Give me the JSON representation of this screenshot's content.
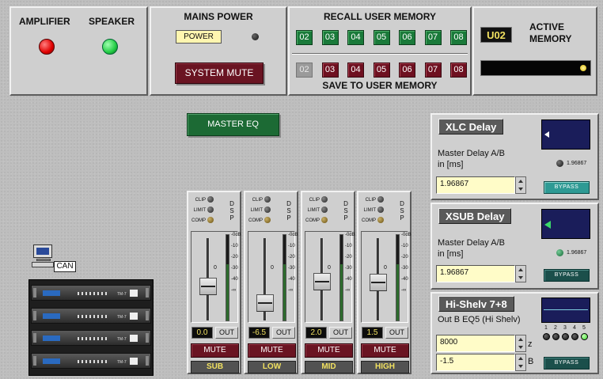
{
  "status": {
    "amplifier_label": "AMPLIFIER",
    "speaker_label": "SPEAKER",
    "amplifier_led_color": "#e00000",
    "speaker_led_color": "#22cc44"
  },
  "mains": {
    "title": "MAINS POWER",
    "power_label": "POWER",
    "system_mute_label": "SYSTEM MUTE"
  },
  "memory": {
    "recall_title": "RECALL USER MEMORY",
    "save_title": "SAVE TO USER MEMORY",
    "recall_slots": [
      "02",
      "03",
      "04",
      "05",
      "06",
      "07",
      "08"
    ],
    "save_slots": [
      "02",
      "03",
      "04",
      "05",
      "06",
      "07",
      "08"
    ]
  },
  "active_memory": {
    "current": "U02",
    "label_line1": "ACTIVE",
    "label_line2": "MEMORY"
  },
  "master_eq_label": "MASTER EQ",
  "can_label": "CAN",
  "channels": [
    {
      "name": "SUB",
      "value": "0.0",
      "out_label": "OUT",
      "mute_label": "MUTE",
      "fader_db": 0
    },
    {
      "name": "LOW",
      "value": "-6.5",
      "out_label": "OUT",
      "mute_label": "MUTE",
      "fader_db": -6.5
    },
    {
      "name": "MID",
      "value": "2.0",
      "out_label": "OUT",
      "mute_label": "MUTE",
      "fader_db": 2.0
    },
    {
      "name": "HIGH",
      "value": "1.5",
      "out_label": "OUT",
      "mute_label": "MUTE",
      "fader_db": 1.5
    }
  ],
  "dsp": {
    "clip": "CLIP",
    "limit": "LIMIT",
    "comp": "COMP",
    "d": "D",
    "s": "S",
    "p": "P"
  },
  "meter_scale": [
    "-0dB",
    "-10",
    "-20",
    "-30",
    "-40",
    "-∞"
  ],
  "fader_zero_label": "0",
  "panels": {
    "xlc": {
      "title": "XLC Delay",
      "label_line1": "Master Delay A/B",
      "label_line2": "in [ms]",
      "value": "1.96867",
      "readout": "1.96867",
      "bypass_label": "BYPASS",
      "bypass_color": "#2e9a94"
    },
    "xsub": {
      "title": "XSUB Delay",
      "label_line1": "Master Delay A/B",
      "label_line2": "in [ms]",
      "value": "1.96867",
      "readout": "1.96867",
      "bypass_label": "BYPASS",
      "bypass_color": "#1b4f4b"
    },
    "hishelv": {
      "title": "Hi-Shelv 7+8",
      "subtitle": "Out B EQ5 (Hi Shelv)",
      "freq_value": "8000",
      "freq_unit": "z",
      "gain_value": "-1.5",
      "gain_unit": "B",
      "band_numbers": [
        "1",
        "2",
        "3",
        "4",
        "5"
      ],
      "bypass_label": "BYPASS",
      "bypass_color": "#1b4f4b"
    }
  }
}
